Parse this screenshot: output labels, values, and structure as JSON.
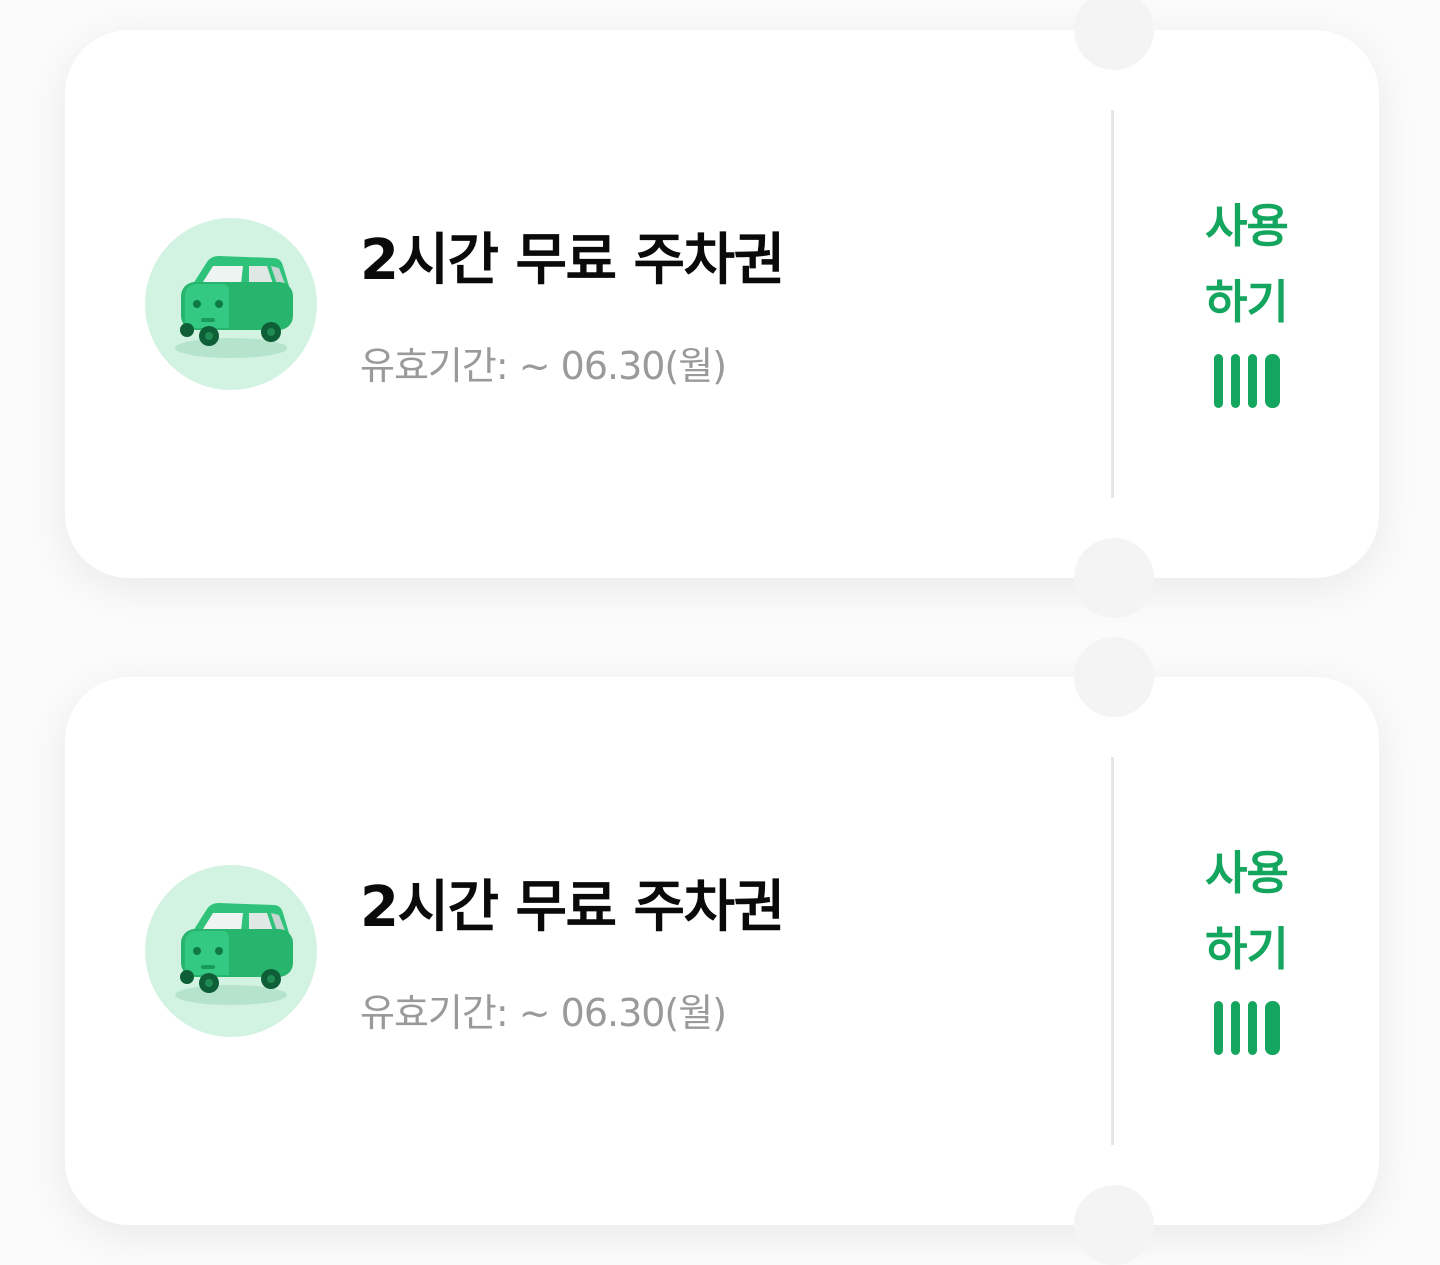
{
  "colors": {
    "accent": "#14a55e",
    "icon_bg": "#d2f3e2",
    "title": "#0a0a0a",
    "expiry": "#9a9a9a"
  },
  "coupons": [
    {
      "icon": "car-icon",
      "title": "2시간 무료 주차권",
      "expiry": "유효기간: ~ 06.30(월)",
      "use_label_line1": "사용",
      "use_label_line2": "하기",
      "use_icon": "barcode-icon"
    },
    {
      "icon": "car-icon",
      "title": "2시간 무료 주차권",
      "expiry": "유효기간: ~ 06.30(월)",
      "use_label_line1": "사용",
      "use_label_line2": "하기",
      "use_icon": "barcode-icon"
    }
  ]
}
